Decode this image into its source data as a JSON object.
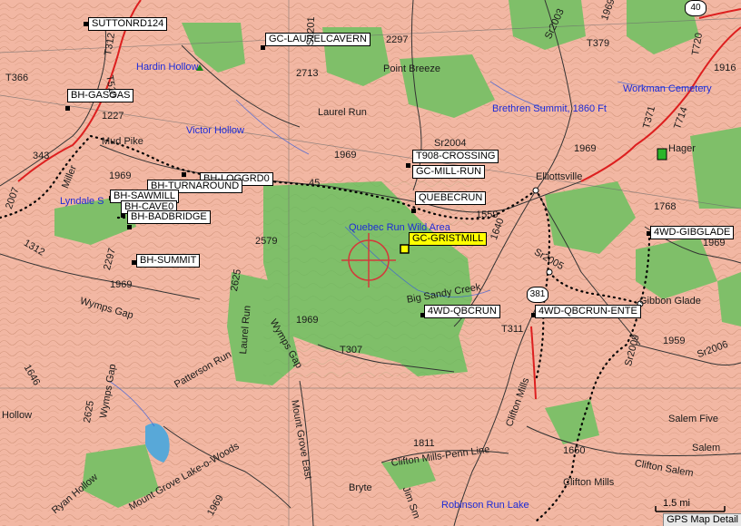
{
  "map": {
    "status_text": "GPS Map Detail",
    "scale_label": "1.5 mi",
    "selected_waypoint": "GC-GRISTMILL"
  },
  "waypoints": {
    "suttonrd124": "SUTTONRD124",
    "gc_laurelcavern": "GC-LAURELCAVERN",
    "bh_gasgas": "BH-GASGAS",
    "t908_crossing": "T908-CROSSING",
    "gc_mill_run": "GC-MILL-RUN",
    "bh_turnaround": "BH-TURNAROUND",
    "bh_loggrd": "BH-LOGGRD0",
    "quebecrun": "QUEBECRUN",
    "bh_sawmill": "BH-SAWMILL",
    "bh_cave": "BH-CAVE0",
    "bh_badbridge": "BH-BADBRIDGE",
    "gc_gristmill": "GC-GRISTMILL",
    "bh_summit": "BH-SUMMIT",
    "fourwd_gibglade": "4WD-GIBGLADE",
    "fourwd_qbcrun": "4WD-QBCRUN",
    "fourwd_qbcrun_ente": "4WD-QBCRUN-ENTE"
  },
  "places": {
    "hardin_hollow": "Hardin Hollow",
    "point_breeze": "Point Breeze",
    "workman_cemetery": "Workman Cemetery",
    "brethren_summit": "Brethren Summit, 1860 Ft",
    "laurel_run": "Laurel Run",
    "victor_hollow": "Victor Hollow",
    "mud_pike": "Mud Pike",
    "hager": "Hager",
    "elliottsville": "Elliottsville",
    "miller": "Miller",
    "lyndale": "Lyndale S",
    "quebec_run_wild_area": "Quebec Run Wild Area",
    "big_sandy_creek": "Big Sandy Creek",
    "gibbon_glade": "Gibbon Glade",
    "wymps_gap": "Wymps Gap",
    "laurel_run_2": "Laurel Run",
    "wymps_gap_2": "Wymps Gap",
    "wymps_gap_3": "Wymps Gap",
    "patterson_run": "Patterson Run",
    "mount_grove_lake_o_woods": "Mount Grove Lake-o-Woods",
    "mount_grove_east": "Mount Grove East",
    "clifton_mills_penn_line": "Clifton Mills-Penn Line",
    "clifton_mills": "Clifton Mills",
    "clifton_mills_2": "Clifton Mills",
    "clifton_salem": "Clifton Salem",
    "salem": "Salem",
    "salem_five": "Salem Five",
    "bryte": "Bryte",
    "ryan_hollow": "Ryan Hollow",
    "hollow": "Hollow",
    "robinson_run_lake": "Robinson Run Lake",
    "jim_smith": "Jim Sm"
  },
  "road_labels": {
    "t366": "T366",
    "t312": "T312",
    "t510": "T510",
    "s1312": "1312",
    "t379": "T379",
    "t720": "T720",
    "t714": "T714",
    "t371": "T371",
    "sr2003": "Sr2003",
    "sr2004": "Sr2004",
    "sr2005": "Sr2005",
    "sr2009": "Sr2009",
    "sr2006": "Sr2006",
    "t311": "T311",
    "t307": "T307",
    "sr1916": "1916",
    "s2297": "2297",
    "s2713": "2713",
    "s1227": "1227",
    "s343": "343",
    "s1969_a": "1969",
    "s1969_b": "1969",
    "s1969_c": "1969",
    "s1969_d": "1969",
    "s1969_e": "1969",
    "s1969_f": "1969",
    "s1969_g": "1969",
    "s2579": "2579",
    "s2625": "2625",
    "s2625_b": "2625",
    "s2297_b": "2297",
    "s1646": "1646",
    "s1640": "1640",
    "s1959": "1959",
    "s1768": "1768",
    "s1811": "1811",
    "s1650": "1650",
    "s1559": "1559",
    "s2007": "2007",
    "s1201": "S1201",
    "s45": "45",
    "s1969_h": "1969",
    "shield_381": "381",
    "shield_40": "40"
  }
}
